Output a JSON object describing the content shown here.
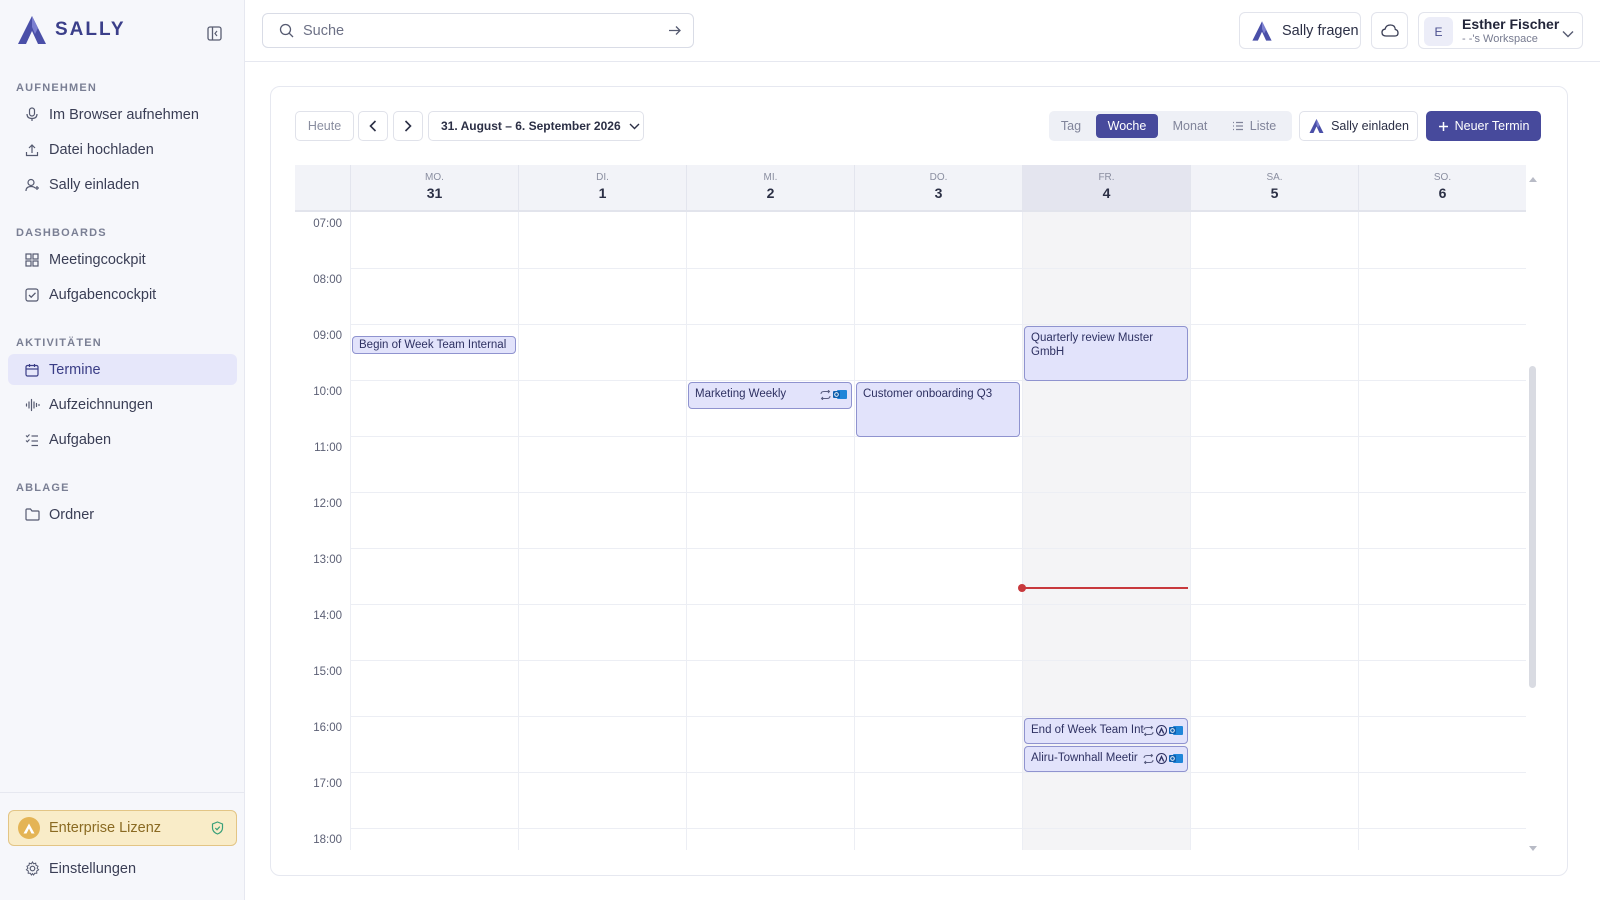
{
  "app": {
    "logo_text": "SALLY"
  },
  "sidebar": {
    "sections": [
      {
        "title": "AUFNEHMEN",
        "items": [
          {
            "label": "Im Browser aufnehmen",
            "icon": "microphone-icon"
          },
          {
            "label": "Datei hochladen",
            "icon": "upload-icon"
          },
          {
            "label": "Sally einladen",
            "icon": "add-user-icon"
          }
        ]
      },
      {
        "title": "DASHBOARDS",
        "items": [
          {
            "label": "Meetingcockpit",
            "icon": "grid-icon"
          },
          {
            "label": "Aufgabencockpit",
            "icon": "checkbox-icon"
          }
        ]
      },
      {
        "title": "AKTIVITÄTEN",
        "items": [
          {
            "label": "Termine",
            "icon": "calendar-icon",
            "active": true
          },
          {
            "label": "Aufzeichnungen",
            "icon": "waveform-icon"
          },
          {
            "label": "Aufgaben",
            "icon": "checklist-icon"
          }
        ]
      },
      {
        "title": "ABLAGE",
        "items": [
          {
            "label": "Ordner",
            "icon": "folder-icon"
          }
        ]
      }
    ],
    "license_label": "Enterprise Lizenz",
    "settings_label": "Einstellungen"
  },
  "topbar": {
    "search_placeholder": "Suche",
    "ask_label": "Sally fragen",
    "user_initial": "E",
    "user_name": "Esther Fischer",
    "workspace": "- -'s Workspace"
  },
  "toolbar": {
    "today_label": "Heute",
    "date_range": "31. August – 6. September 2026",
    "views": [
      "Tag",
      "Woche",
      "Monat",
      "Liste"
    ],
    "active_view": "Woche",
    "invite_label": "Sally einladen",
    "new_event_label": "Neuer Termin"
  },
  "calendar": {
    "days": [
      {
        "abbr": "MO.",
        "num": "31"
      },
      {
        "abbr": "DI.",
        "num": "1"
      },
      {
        "abbr": "MI.",
        "num": "2"
      },
      {
        "abbr": "DO.",
        "num": "3"
      },
      {
        "abbr": "FR.",
        "num": "4",
        "highlight": true
      },
      {
        "abbr": "SA.",
        "num": "5"
      },
      {
        "abbr": "SO.",
        "num": "6"
      }
    ],
    "hours": [
      "07:00",
      "08:00",
      "09:00",
      "10:00",
      "11:00",
      "12:00",
      "13:00",
      "14:00",
      "15:00",
      "16:00",
      "17:00",
      "18:00"
    ],
    "events": [
      {
        "title": "Begin of Week Team Internal",
        "day": 0,
        "start": "09:00"
      },
      {
        "title": "Marketing Weekly",
        "day": 2,
        "start": "10:00",
        "icons": [
          "repeat-icon",
          "outlook-icon"
        ]
      },
      {
        "title": "Customer onboarding Q3",
        "day": 3,
        "start": "10:00"
      },
      {
        "title": "Quarterly review Muster GmbH",
        "day": 4,
        "start": "09:00"
      },
      {
        "title": "End of Week Team Int",
        "day": 4,
        "start": "16:00",
        "icons": [
          "repeat-icon",
          "sally-icon",
          "outlook-icon"
        ]
      },
      {
        "title": "Aliru-Townhall Meetir",
        "day": 4,
        "start": "16:30",
        "icons": [
          "repeat-icon",
          "sally-icon",
          "outlook-icon"
        ]
      }
    ]
  },
  "colors": {
    "accent": "#474a9c",
    "now_line": "#c8393d",
    "license_bg": "#f9ecc8"
  }
}
